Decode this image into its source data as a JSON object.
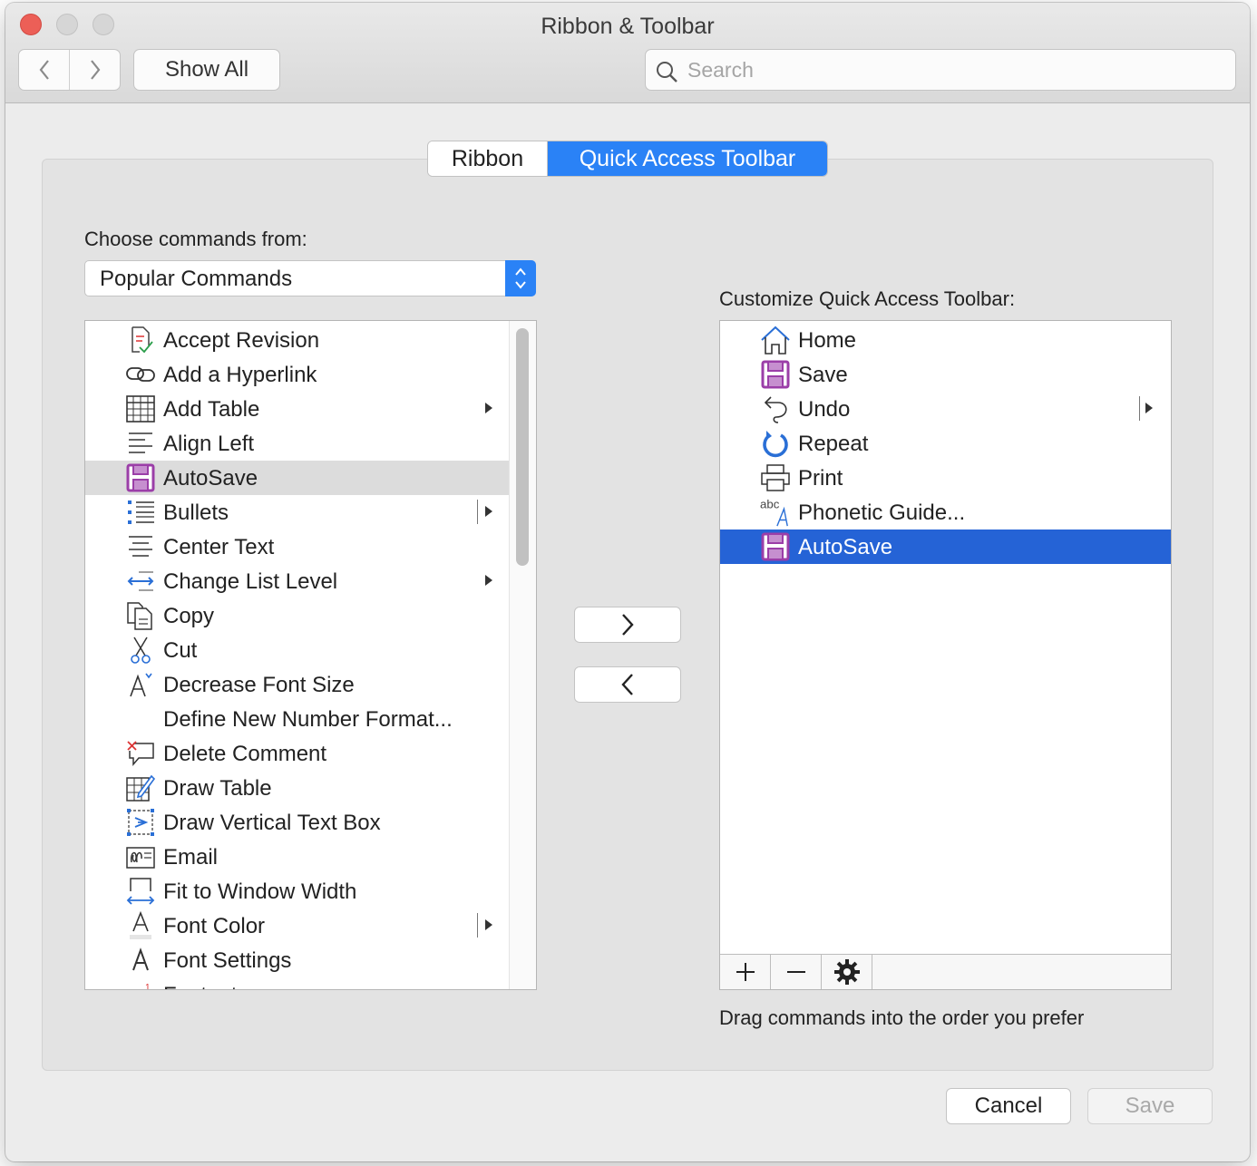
{
  "window": {
    "title": "Ribbon & Toolbar",
    "show_all": "Show All",
    "search_placeholder": "Search"
  },
  "tabs": [
    {
      "label": "Ribbon",
      "selected": false
    },
    {
      "label": "Quick Access Toolbar",
      "selected": true
    }
  ],
  "left": {
    "label": "Choose commands from:",
    "dropdown_value": "Popular Commands",
    "items": [
      {
        "label": "Accept Revision",
        "icon": "accept-revision-icon"
      },
      {
        "label": "Add a Hyperlink",
        "icon": "hyperlink-icon"
      },
      {
        "label": "Add Table",
        "icon": "table-icon",
        "submenu": true
      },
      {
        "label": "Align Left",
        "icon": "align-left-icon"
      },
      {
        "label": "AutoSave",
        "icon": "autosave-icon",
        "selected": true
      },
      {
        "label": "Bullets",
        "icon": "bullets-icon",
        "split": true
      },
      {
        "label": "Center Text",
        "icon": "center-text-icon"
      },
      {
        "label": "Change List Level",
        "icon": "change-list-level-icon",
        "submenu": true
      },
      {
        "label": "Copy",
        "icon": "copy-icon"
      },
      {
        "label": "Cut",
        "icon": "scissors-icon"
      },
      {
        "label": "Decrease Font Size",
        "icon": "decrease-font-size-icon"
      },
      {
        "label": "Define New Number Format...",
        "icon": ""
      },
      {
        "label": "Delete Comment",
        "icon": "delete-comment-icon"
      },
      {
        "label": "Draw Table",
        "icon": "draw-table-icon"
      },
      {
        "label": "Draw Vertical Text Box",
        "icon": "vertical-text-box-icon"
      },
      {
        "label": "Email",
        "icon": "email-icon"
      },
      {
        "label": "Fit to Window Width",
        "icon": "fit-width-icon"
      },
      {
        "label": "Font Color",
        "icon": "font-color-icon",
        "split": true
      },
      {
        "label": "Font Settings",
        "icon": "font-settings-icon"
      },
      {
        "label": "Footnote",
        "icon": "footnote-icon"
      }
    ]
  },
  "right": {
    "label": "Customize Quick Access Toolbar:",
    "items": [
      {
        "label": "Home",
        "icon": "home-icon"
      },
      {
        "label": "Save",
        "icon": "save-icon"
      },
      {
        "label": "Undo",
        "icon": "undo-icon",
        "split": true
      },
      {
        "label": "Repeat",
        "icon": "repeat-icon"
      },
      {
        "label": "Print",
        "icon": "print-icon"
      },
      {
        "label": "Phonetic Guide...",
        "icon": "phonetic-guide-icon"
      },
      {
        "label": "AutoSave",
        "icon": "autosave-icon",
        "selected": true
      }
    ],
    "hint": "Drag commands into the order you prefer"
  },
  "buttons": {
    "cancel": "Cancel",
    "save": "Save"
  },
  "colors": {
    "accent": "#2a82f6",
    "selection": "#2563d6",
    "autosave": "#9b3ea8"
  }
}
